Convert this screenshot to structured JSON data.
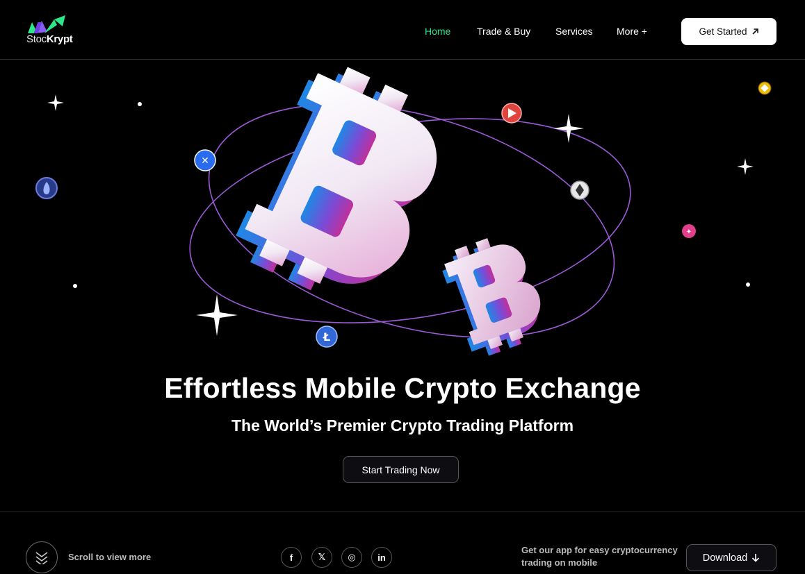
{
  "brand": {
    "logo_text_light": "Stoc",
    "logo_text_bold": "Krypt",
    "colors": {
      "green": "#2ee68a",
      "purple": "#8b5cf6",
      "accent_pink": "#c040b0",
      "accent_blue": "#1e88e5"
    }
  },
  "nav": {
    "items": [
      {
        "label": "Home",
        "active": true
      },
      {
        "label": "Trade & Buy",
        "active": false
      },
      {
        "label": "Services",
        "active": false
      },
      {
        "label": "More +",
        "active": false
      }
    ],
    "cta_label": "Get Started",
    "cta_icon": "arrow-up-right-icon"
  },
  "hero": {
    "title": "Effortless Mobile Crypto Exchange",
    "subtitle": "The World’s Premier Crypto Trading Platform",
    "cta_label": "Start Trading Now",
    "coin_icons": [
      "ripple-coin-icon",
      "tron-coin-icon",
      "ethereum-coin-icon",
      "litecoin-coin-icon",
      "huobi-coin-icon",
      "bnb-coin-icon",
      "pink-coin-icon",
      "bitcoin-large-icon",
      "bitcoin-small-icon"
    ]
  },
  "footer": {
    "scroll_label": "Scroll to view more",
    "social": [
      {
        "icon": "facebook-icon",
        "glyph": "f"
      },
      {
        "icon": "x-icon",
        "glyph": "𝕏"
      },
      {
        "icon": "instagram-icon",
        "glyph": "◎"
      },
      {
        "icon": "linkedin-icon",
        "glyph": "in"
      }
    ],
    "app_text": "Get our app for easy cryptocurrency trading on mobile",
    "download_label": "Download",
    "download_icon": "arrow-down-icon"
  }
}
